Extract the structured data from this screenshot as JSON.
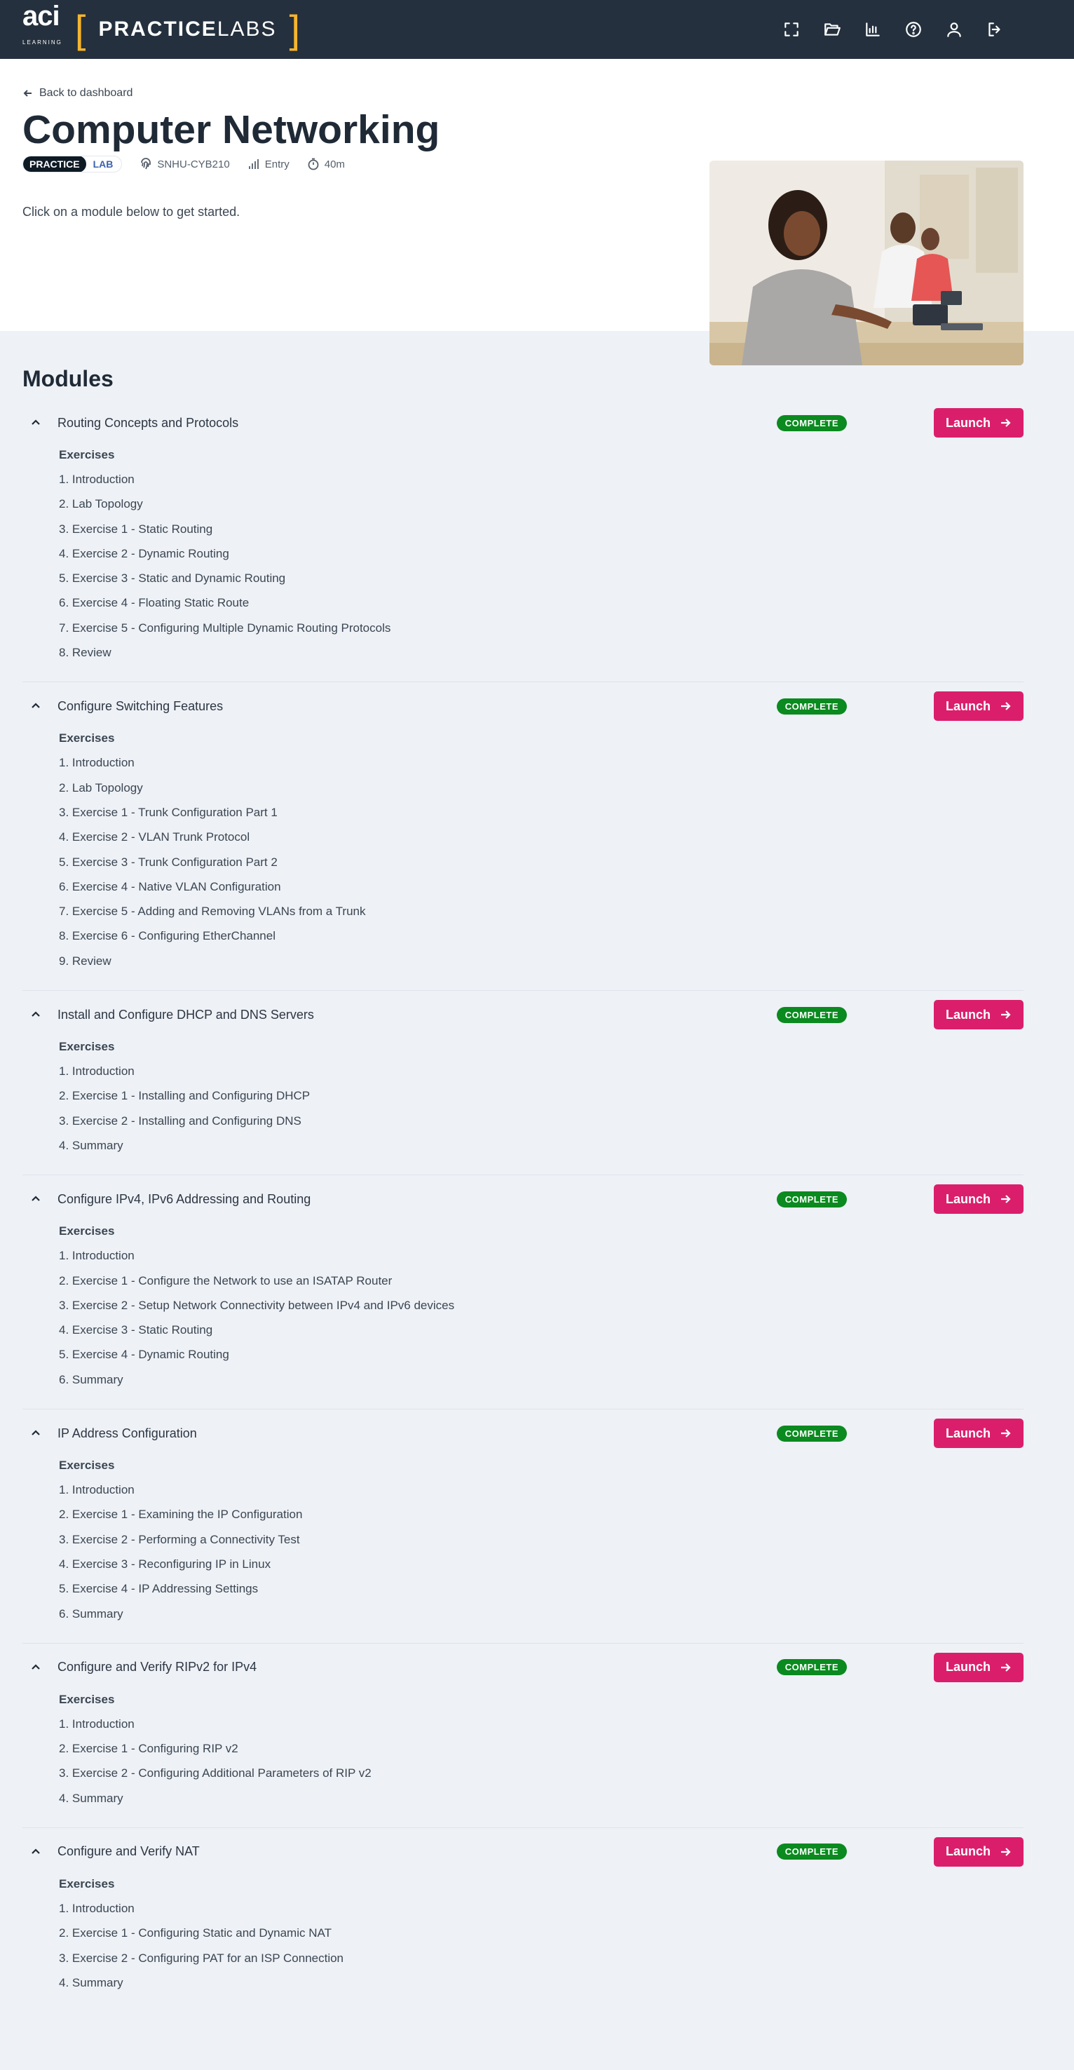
{
  "brand": {
    "aci": "aci",
    "aci_sub": "LEARNING",
    "pl_bold": "PRACTICE",
    "pl_light": "LABS"
  },
  "nav_icons": [
    "fullscreen-icon",
    "folder-icon",
    "chart-icon",
    "help-icon",
    "user-icon",
    "logout-icon"
  ],
  "hero": {
    "back_label": "Back to dashboard",
    "title": "Computer Networking",
    "badge_practice": "PRACTICE",
    "badge_lab": "LAB",
    "course_code": "SNHU-CYB210",
    "level": "Entry",
    "duration": "40m",
    "intro": "Click on a module below to get started."
  },
  "modules_title": "Modules",
  "exercises_label": "Exercises",
  "status_label": "COMPLETE",
  "launch_label": "Launch",
  "modules": [
    {
      "name": "Routing Concepts and Protocols",
      "items": [
        "1. Introduction",
        "2. Lab Topology",
        "3. Exercise 1 - Static Routing",
        "4. Exercise 2 - Dynamic Routing",
        "5. Exercise 3 - Static and Dynamic Routing",
        "6. Exercise 4 - Floating Static Route",
        "7. Exercise 5 - Configuring Multiple Dynamic Routing Protocols",
        "8. Review"
      ]
    },
    {
      "name": "Configure Switching Features",
      "items": [
        "1. Introduction",
        "2. Lab Topology",
        "3. Exercise 1 - Trunk Configuration Part 1",
        "4. Exercise 2 - VLAN Trunk Protocol",
        "5. Exercise 3 - Trunk Configuration Part 2",
        "6. Exercise 4 - Native VLAN Configuration",
        "7. Exercise 5 - Adding and Removing VLANs from a Trunk",
        "8. Exercise 6 - Configuring EtherChannel",
        "9. Review"
      ]
    },
    {
      "name": "Install and Configure DHCP and DNS Servers",
      "items": [
        "1. Introduction",
        "2. Exercise 1 - Installing and Configuring DHCP",
        "3. Exercise 2 - Installing and Configuring DNS",
        "4. Summary"
      ]
    },
    {
      "name": "Configure IPv4, IPv6 Addressing and Routing",
      "items": [
        "1. Introduction",
        "2. Exercise 1 - Configure the Network to use an ISATAP Router",
        "3. Exercise 2 - Setup Network Connectivity between IPv4 and IPv6 devices",
        "4. Exercise 3 - Static Routing",
        "5. Exercise 4 - Dynamic Routing",
        "6. Summary"
      ]
    },
    {
      "name": "IP Address Configuration",
      "items": [
        "1. Introduction",
        "2. Exercise 1 - Examining the IP Configuration",
        "3. Exercise 2 - Performing a Connectivity Test",
        "4. Exercise 3 - Reconfiguring IP in Linux",
        "5. Exercise 4 - IP Addressing Settings",
        "6. Summary"
      ]
    },
    {
      "name": "Configure and Verify RIPv2 for IPv4",
      "items": [
        "1. Introduction",
        "2. Exercise 1 - Configuring RIP v2",
        "3. Exercise 2 - Configuring Additional Parameters of RIP v2",
        "4. Summary"
      ]
    },
    {
      "name": "Configure and Verify NAT",
      "items": [
        "1. Introduction",
        "2. Exercise 1 - Configuring Static and Dynamic NAT",
        "3. Exercise 2 - Configuring PAT for an ISP Connection",
        "4. Summary"
      ]
    }
  ]
}
